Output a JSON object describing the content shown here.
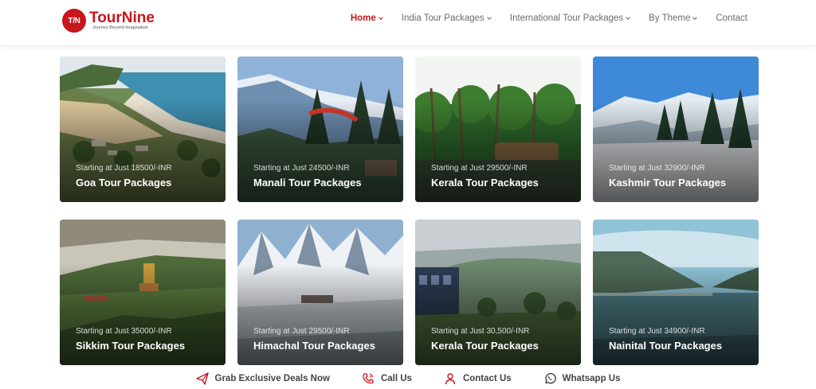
{
  "brand": {
    "badge": "T/N",
    "name": "TourNine",
    "tagline": "Journey Beyond Imagination",
    "color": "#c8161d"
  },
  "nav": [
    {
      "label": "Home",
      "active": true,
      "dropdown": true
    },
    {
      "label": "India Tour Packages",
      "active": false,
      "dropdown": true
    },
    {
      "label": "International Tour Packages",
      "active": false,
      "dropdown": true
    },
    {
      "label": "By Theme",
      "active": false,
      "dropdown": true
    },
    {
      "label": "Contact",
      "active": false,
      "dropdown": false
    }
  ],
  "packages": [
    {
      "price": "Starting at Just 18500/-INR",
      "title": "Goa Tour Packages",
      "scene": "beach"
    },
    {
      "price": "Starting at Just 24500/-INR",
      "title": "Manali Tour Packages",
      "scene": "paraglide"
    },
    {
      "price": "Starting at Just 29500/-INR",
      "title": "Kerala Tour Packages",
      "scene": "palms"
    },
    {
      "price": "Starting at Just 32900/-INR",
      "title": "Kashmir Tour Packages",
      "scene": "snow"
    },
    {
      "price": "Starting at Just 35000/-INR",
      "title": "Sikkim Tour Packages",
      "scene": "monastery"
    },
    {
      "price": "Starting at Just 29500/-INR",
      "title": "Himachal Tour Packages",
      "scene": "peaks"
    },
    {
      "price": "Starting at Just 30,500/-INR",
      "title": "Kerala Tour Packages",
      "scene": "train"
    },
    {
      "price": "Starting at Just 34900/-INR",
      "title": "Nainital Tour Packages",
      "scene": "lake"
    }
  ],
  "footer": [
    {
      "label": "Grab Exclusive Deals Now",
      "icon": "paper-plane-icon"
    },
    {
      "label": "Call Us",
      "icon": "phone-icon"
    },
    {
      "label": "Contact Us",
      "icon": "person-icon"
    },
    {
      "label": "Whatsapp Us",
      "icon": "whatsapp-icon"
    }
  ]
}
